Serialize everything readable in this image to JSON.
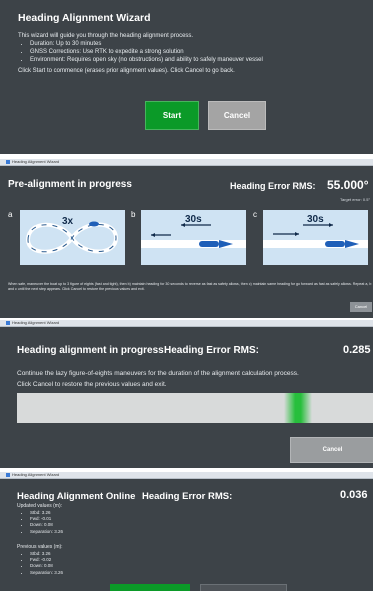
{
  "colors": {
    "background": "#3d4348",
    "accent_green": "#0b9a28",
    "button_gray": "#a4a4a4",
    "illustration_blue": "#cfe3f3"
  },
  "wizard_intro": {
    "title": "Heading Alignment Wizard",
    "description": "This wizard will guide you through the heading alignment process.",
    "bullets": [
      "Duration: Up to 30 minutes",
      "GNSS Corrections: Use RTK to expedite a strong solution",
      "Environment: Requires open sky (no obstructions) and ability to safely maneuver vessel"
    ],
    "note": "Click Start to commence (erases prior alignment values). Click Cancel to go back.",
    "start_label": "Start",
    "cancel_label": "Cancel"
  },
  "prealign": {
    "window_title": "Heading Alignment Wizard",
    "title": "Pre-alignment in progress",
    "rms_label": "Heading Error RMS:",
    "rms_value": "55.000°",
    "target": "Target error: 0.5°",
    "steps": [
      {
        "label": "a",
        "caption": "3x"
      },
      {
        "label": "b",
        "caption": "30s"
      },
      {
        "label": "c",
        "caption": "30s"
      }
    ],
    "instructions": "When safe, maneuver the boat up to 3 figure of eights (fast and tight), then b) maintain heading for 30 seconds to reverse as fast as safety allows, then c) maintain same heading for go forward as fast as safely allows. Repeat a, b and c until the next step appears. Click Cancel to restore the previous values and exit.",
    "cancel_label": "Cancel"
  },
  "alignment": {
    "window_title": "Heading Alignment Wizard",
    "title": "Heading alignment in progress",
    "rms_label": "Heading Error RMS:",
    "rms_value": "0.285",
    "line1": "Continue the lazy figure-of-eights maneuvers for the duration of the alignment calculation process.",
    "line2": "Click Cancel to restore the previous values and exit.",
    "progress_position": 0.79,
    "cancel_label": "Cancel"
  },
  "online": {
    "window_title": "Heading Alignment Wizard",
    "title": "Heading Alignment Online",
    "rms_label": "Heading Error RMS:",
    "rms_value": "0.036",
    "updated_label": "Updated values (m):",
    "updated": [
      "Stbd: 3.26",
      "Fwd: -0.01",
      "Down: 0.08",
      "Separation: 3.26"
    ],
    "previous_label": "Previous values (m):",
    "previous": [
      "Stbd: 3.26",
      "Fwd: -0.02",
      "Down: 0.08",
      "Separation: 3.26"
    ]
  }
}
